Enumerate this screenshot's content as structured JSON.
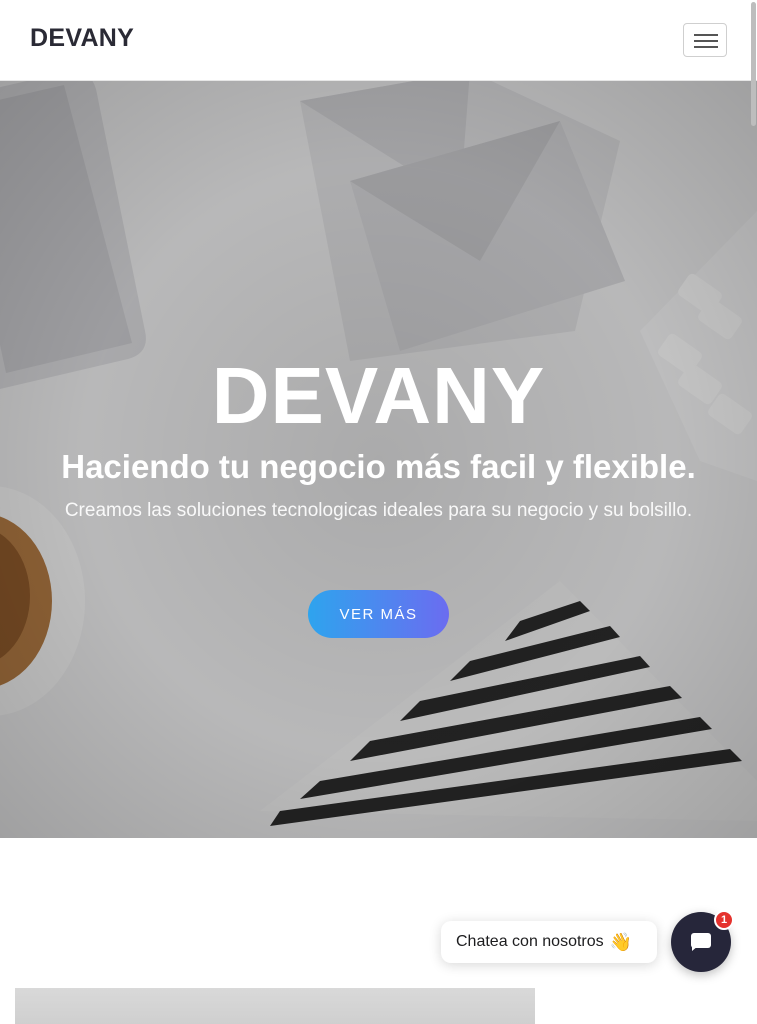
{
  "navbar": {
    "brand": "DEVANY",
    "menu_icon": "hamburger-menu-icon"
  },
  "hero": {
    "title": "DEVANY",
    "subtitle": "Haciendo tu negocio más facil y flexible.",
    "description": "Creamos las soluciones tecnologicas ideales para su negocio y su bolsillo.",
    "cta_label": "VER MÁS"
  },
  "chat": {
    "prompt": "Chatea con nosotros",
    "emoji": "👋",
    "launcher_icon": "chat-bubble-icon",
    "badge_count": "1"
  },
  "colors": {
    "accent_start": "#2ea4ee",
    "accent_end": "#6b6cf0",
    "chat_launcher": "#26263a",
    "badge": "#e5322d"
  }
}
